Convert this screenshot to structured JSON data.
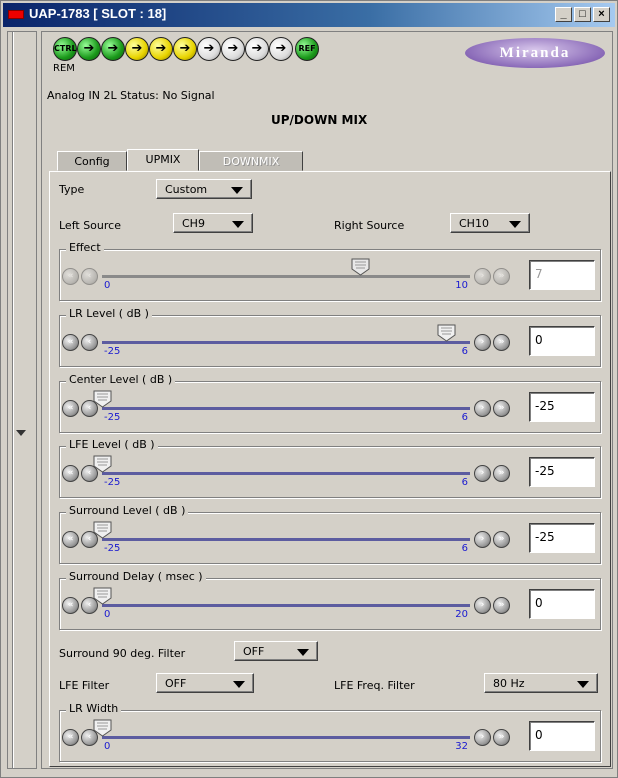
{
  "window": {
    "title": "UAP-1783 [ SLOT : 18]"
  },
  "status": {
    "leds": [
      "CTRL",
      "",
      "",
      "",
      "",
      "",
      "",
      "",
      "",
      "",
      "REF"
    ],
    "rem": "REM",
    "logo": "Miranda",
    "status_line": "Analog IN 2L Status: No Signal"
  },
  "heading": "UP/DOWN MIX",
  "tabs": [
    {
      "label": "Config",
      "state": "inactive"
    },
    {
      "label": "UPMIX",
      "state": "active"
    },
    {
      "label": "DOWNMIX",
      "state": "disabled"
    }
  ],
  "fields": {
    "type_label": "Type",
    "type_value": "Custom",
    "left_source_label": "Left Source",
    "left_source_value": "CH9",
    "right_source_label": "Right Source",
    "right_source_value": "CH10",
    "surround90_label": "Surround 90 deg. Filter",
    "surround90_value": "OFF",
    "lfe_filter_label": "LFE Filter",
    "lfe_filter_value": "OFF",
    "lfe_freq_label": "LFE Freq. Filter",
    "lfe_freq_value": "80 Hz"
  },
  "sliders": [
    {
      "label": "Effect",
      "min": "0",
      "max": "10",
      "value": "7",
      "disabled": true
    },
    {
      "label": "LR Level ( dB )",
      "min": "-25",
      "max": "6",
      "value": "0",
      "disabled": false
    },
    {
      "label": "Center Level ( dB )",
      "min": "-25",
      "max": "6",
      "value": "-25",
      "disabled": false
    },
    {
      "label": "LFE Level ( dB )",
      "min": "-25",
      "max": "6",
      "value": "-25",
      "disabled": false
    },
    {
      "label": "Surround Level ( dB )",
      "min": "-25",
      "max": "6",
      "value": "-25",
      "disabled": false
    },
    {
      "label": "Surround Delay ( msec )",
      "min": "0",
      "max": "20",
      "value": "0",
      "disabled": false
    },
    {
      "label": "LR Width",
      "min": "0",
      "max": "32",
      "value": "0",
      "disabled": false
    }
  ],
  "colors": {
    "title_bar": "#0a246a",
    "led_green": "#1b9a1b",
    "led_yellow": "#e8d400",
    "slider_track": "#5c5ca0",
    "tick_text": "#1a1ad0"
  }
}
